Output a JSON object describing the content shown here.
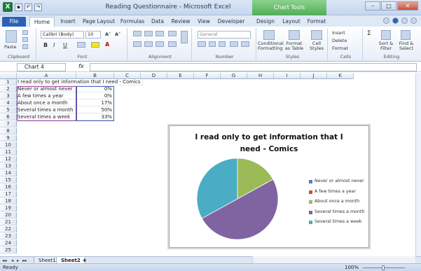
{
  "window": {
    "title": "Reading Questionnaire - Microsoft Excel",
    "chart_tools_label": "Chart Tools",
    "app_icon": "excel-icon"
  },
  "tabs": [
    "File",
    "Home",
    "Insert",
    "Page Layout",
    "Formulas",
    "Data",
    "Review",
    "View",
    "Developer",
    "Design",
    "Layout",
    "Format"
  ],
  "ribbon": {
    "clipboard": {
      "label": "Clipboard",
      "paste": "Paste"
    },
    "font": {
      "label": "Font",
      "font_name": "Calibri (Body)",
      "font_size": "10",
      "bold": "B",
      "italic": "I",
      "underline": "U"
    },
    "alignment": {
      "label": "Alignment"
    },
    "number": {
      "label": "Number",
      "format": "General"
    },
    "styles": {
      "label": "Styles",
      "conditional": "Conditional Formatting",
      "format_table": "Format as Table",
      "cell_styles": "Cell Styles"
    },
    "cells": {
      "label": "Cells",
      "insert": "Insert",
      "delete": "Delete",
      "format": "Format"
    },
    "editing": {
      "label": "Editing",
      "sort": "Sort & Filter",
      "find": "Find & Select"
    }
  },
  "formula_bar": {
    "name_box": "Chart 4",
    "fx": "fx",
    "content": ""
  },
  "columns": [
    "A",
    "B",
    "C",
    "D",
    "E",
    "F",
    "G",
    "H",
    "I",
    "J",
    "K"
  ],
  "rows": [
    "1",
    "2",
    "3",
    "4",
    "5",
    "6",
    "7",
    "8",
    "9",
    "10",
    "11",
    "12",
    "13",
    "14",
    "15",
    "16",
    "17",
    "18",
    "19",
    "20",
    "21",
    "22",
    "23",
    "24",
    "25"
  ],
  "cells": {
    "a1": "I read only to get information that I need - Comics",
    "data": [
      {
        "label": "Never or almost never",
        "value": "0%"
      },
      {
        "label": "A few times a year",
        "value": "0%"
      },
      {
        "label": "About once a month",
        "value": "17%"
      },
      {
        "label": "Several times a month",
        "value": "50%"
      },
      {
        "label": "Several times a week",
        "value": "33%"
      }
    ]
  },
  "chart_data": {
    "type": "pie",
    "title": "I read only to get information that I need - Comics",
    "categories": [
      "Never or almost never",
      "A few times a year",
      "About once a month",
      "Several times a month",
      "Several times a week"
    ],
    "values": [
      0,
      0,
      17,
      50,
      33
    ],
    "colors": [
      "#4f81bd",
      "#c0504d",
      "#9bbb59",
      "#8064a2",
      "#4bacc6"
    ],
    "legend": "right"
  },
  "sheets": [
    "Sheet1",
    "Sheet2"
  ],
  "active_sheet": "Sheet2",
  "status": {
    "mode": "Ready",
    "zoom": "100%"
  }
}
